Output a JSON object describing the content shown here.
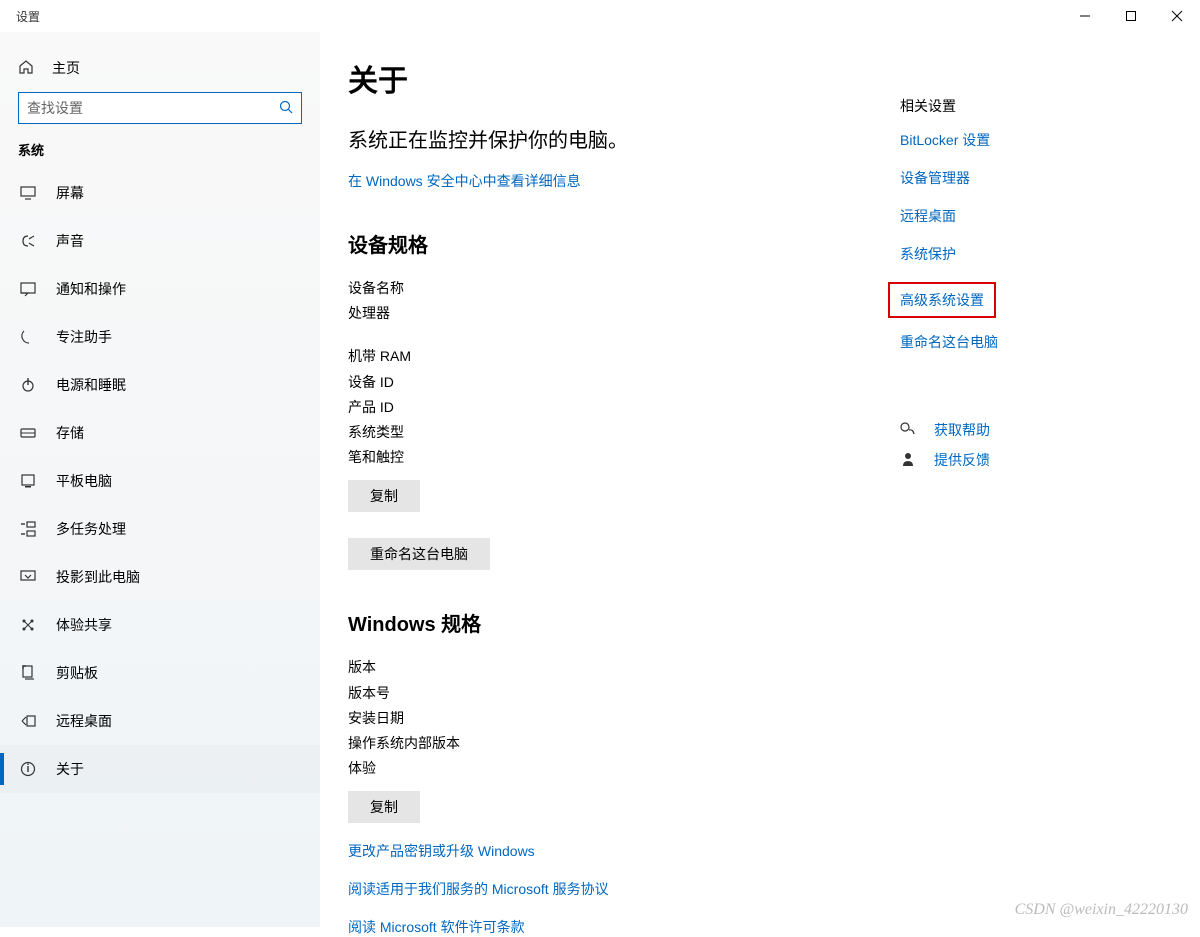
{
  "window_title": "设置",
  "sidebar": {
    "home_label": "主页",
    "search_placeholder": "查找设置",
    "section_label": "系统",
    "items": [
      {
        "label": "屏幕"
      },
      {
        "label": "声音"
      },
      {
        "label": "通知和操作"
      },
      {
        "label": "专注助手"
      },
      {
        "label": "电源和睡眠"
      },
      {
        "label": "存储"
      },
      {
        "label": "平板电脑"
      },
      {
        "label": "多任务处理"
      },
      {
        "label": "投影到此电脑"
      },
      {
        "label": "体验共享"
      },
      {
        "label": "剪贴板"
      },
      {
        "label": "远程桌面"
      },
      {
        "label": "关于"
      }
    ]
  },
  "main": {
    "title": "关于",
    "status_line": "系统正在监控并保护你的电脑。",
    "security_link": "在 Windows 安全中心中查看详细信息",
    "device_spec_title": "设备规格",
    "device_spec": [
      "设备名称",
      "处理器",
      "机带 RAM",
      "设备 ID",
      "产品 ID",
      "系统类型",
      "笔和触控"
    ],
    "copy_btn": "复制",
    "rename_btn": "重命名这台电脑",
    "win_spec_title": "Windows 规格",
    "win_spec": [
      "版本",
      "版本号",
      "安装日期",
      "操作系统内部版本",
      "体验"
    ],
    "copy_btn2": "复制",
    "links": [
      "更改产品密钥或升级 Windows",
      "阅读适用于我们服务的 Microsoft 服务协议",
      "阅读 Microsoft 软件许可条款"
    ]
  },
  "rail": {
    "title": "相关设置",
    "links": [
      "BitLocker 设置",
      "设备管理器",
      "远程桌面",
      "系统保护",
      "高级系统设置",
      "重命名这台电脑"
    ],
    "highlight_index": 4,
    "help_label": "获取帮助",
    "feedback_label": "提供反馈"
  },
  "watermark": "CSDN @weixin_42220130"
}
